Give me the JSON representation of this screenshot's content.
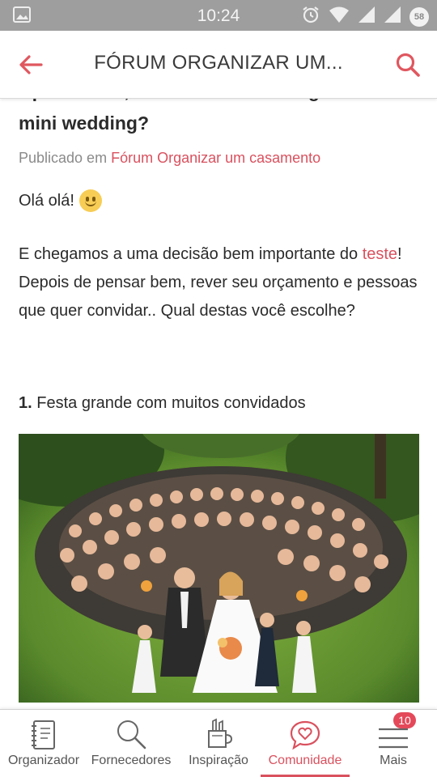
{
  "status_bar": {
    "time": "10:24",
    "battery_level": "58"
  },
  "app_bar": {
    "title": "FÓRUM ORGANIZAR UM..."
  },
  "post": {
    "title": "Apaixonada, mas confusa: festa grande ou mini wedding?",
    "published_prefix": "Publicado em",
    "forum_name": "Fórum Organizar um casamento",
    "greeting": "Olá olá!",
    "paragraph_before_link": "E chegamos a uma decisão bem importante do ",
    "paragraph_link": "teste",
    "paragraph_after_link": "! Depois de pensar bem, rever seu orçamento e pessoas que quer convidar.. Qual destas você escolhe?",
    "option_1_number": "1.",
    "option_1_text": "Festa grande com muitos convidados"
  },
  "bottom_nav": {
    "items": [
      {
        "label": "Organizador",
        "icon": "notebook-icon"
      },
      {
        "label": "Fornecedores",
        "icon": "search-icon"
      },
      {
        "label": "Inspiração",
        "icon": "inspiration-icon"
      },
      {
        "label": "Comunidade",
        "icon": "chat-heart-icon",
        "active": true
      },
      {
        "label": "Mais",
        "icon": "menu-icon",
        "badge": "10"
      }
    ]
  },
  "colors": {
    "accent": "#d9515e",
    "status_bar": "#9e9e9e",
    "text": "#2b2b2b",
    "muted": "#8a8a8a"
  }
}
